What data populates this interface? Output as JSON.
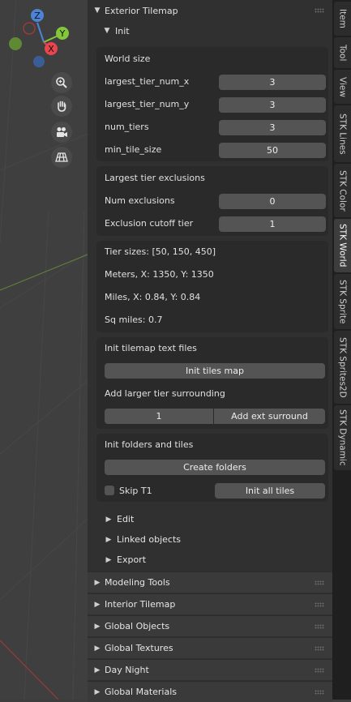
{
  "colors": {
    "x_axis": "#e8454e",
    "y_axis": "#82c83a",
    "z_axis": "#4c83d6",
    "panel_bg": "#303030",
    "box_bg": "#2a2a2a",
    "field_bg": "#545454"
  },
  "viewport_tools": {
    "gizmo_labels": {
      "x": "X",
      "y": "Y",
      "z": "Z"
    },
    "icons": [
      "zoom-icon",
      "hand-pan-icon",
      "camera-icon",
      "grid-ortho-icon"
    ]
  },
  "panel": {
    "title": "Exterior Tilemap",
    "init": {
      "label": "Init",
      "world_size": {
        "title": "World size",
        "fields": [
          {
            "label": "largest_tier_num_x",
            "value": "3"
          },
          {
            "label": "largest_tier_num_y",
            "value": "3"
          },
          {
            "label": "num_tiers",
            "value": "3"
          },
          {
            "label": "min_tile_size",
            "value": "50"
          }
        ]
      },
      "exclusions": {
        "title": "Largest tier exclusions",
        "fields": [
          {
            "label": "Num exclusions",
            "value": "0"
          },
          {
            "label": "Exclusion cutoff tier",
            "value": "1"
          }
        ]
      },
      "info": {
        "lines": [
          "Tier sizes:  [50, 150, 450]",
          "Meters, X:  1350, Y:  1350",
          "Miles, X:  0.84, Y:  0.84",
          "Sq miles:  0.7"
        ]
      },
      "text_files": {
        "title": "Init tilemap text files",
        "init_button": "Init tiles map",
        "surround_label": "Add larger tier surrounding",
        "surround_value": "1",
        "surround_button": "Add ext surround"
      },
      "folders": {
        "title": "Init folders and tiles",
        "create_button": "Create folders",
        "skip_label": "Skip T1",
        "skip_checked": false,
        "init_all_button": "Init all tiles"
      }
    },
    "subpanels": [
      "Edit",
      "Linked objects",
      "Export"
    ]
  },
  "collapsed_panels": [
    "Modeling Tools",
    "Interior Tilemap",
    "Global Objects",
    "Global Textures",
    "Day Night",
    "Global Materials"
  ],
  "tabs": [
    {
      "label": "Item",
      "active": false
    },
    {
      "label": "Tool",
      "active": false
    },
    {
      "label": "View",
      "active": false
    },
    {
      "label": "STK Lines",
      "active": false
    },
    {
      "label": "STK Color",
      "active": false
    },
    {
      "label": "STK World",
      "active": true
    },
    {
      "label": "STK Sprite",
      "active": false
    },
    {
      "label": "STK Sprites2D",
      "active": false
    },
    {
      "label": "STK Dynamic",
      "active": false
    }
  ]
}
